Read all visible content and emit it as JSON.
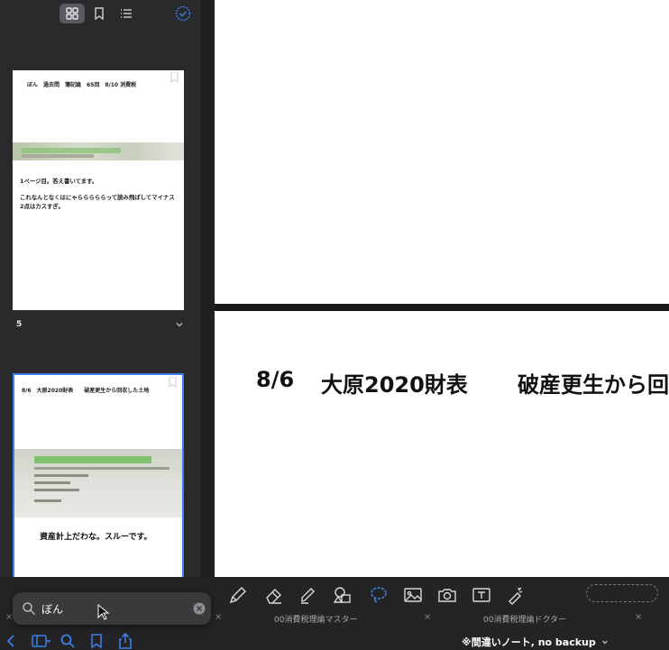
{
  "sidebar": {
    "thumb1": {
      "header": "ぼん　過去問　簿記論　65回　8/10 消費税",
      "line1": "1ページ目。答え書いてます。",
      "line2": "これなんとなくはにゃらららららって読み飛ばしてマイナス2点はカスすぎ。"
    },
    "page_number": "5",
    "thumb2": {
      "header": "8/6　大原2020財表　　破産更生から回収した土地",
      "line1": "資産計上だわな。スルーです。"
    }
  },
  "canvas": {
    "heading_date": "8/6",
    "heading_title": "大原2020財表",
    "heading_tail": "破産更生から回"
  },
  "tabs": [
    {
      "label": "00消費税理論マスター"
    },
    {
      "label": "00消費税理論ドクター"
    }
  ],
  "document_title": "※間違いノート, no backup",
  "search": {
    "value": "ぼん"
  },
  "colors": {
    "accent": "#3d7fe6",
    "background": "#1c1c1e",
    "toolbar": "#242426"
  }
}
